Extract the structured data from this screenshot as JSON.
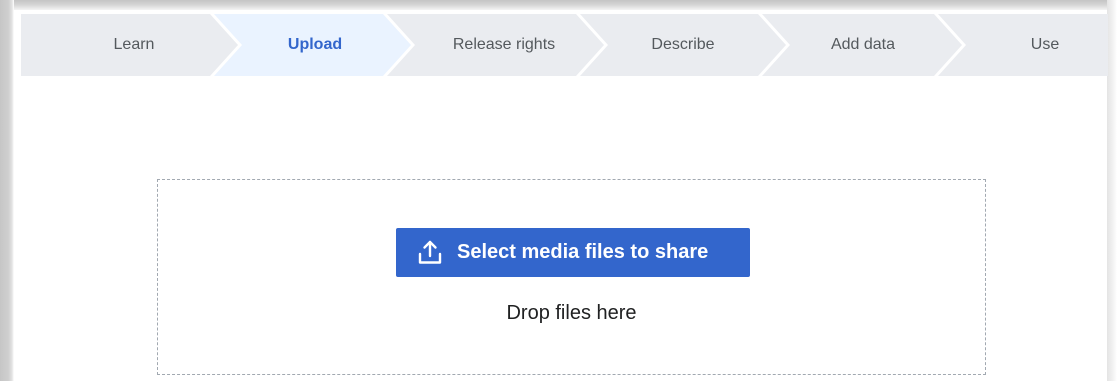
{
  "steps": [
    {
      "label": "Learn",
      "active": false
    },
    {
      "label": "Upload",
      "active": true
    },
    {
      "label": "Release rights",
      "active": false
    },
    {
      "label": "Describe",
      "active": false
    },
    {
      "label": "Add data",
      "active": false
    },
    {
      "label": "Use",
      "active": false
    }
  ],
  "upload": {
    "button_label": "Select media files to share",
    "button_icon": "upload-icon",
    "drop_text": "Drop files here"
  },
  "colors": {
    "accent": "#3366cc",
    "step_inactive_bg": "#eaecf0",
    "step_active_bg": "#eaf3ff",
    "step_text": "#54595d"
  }
}
